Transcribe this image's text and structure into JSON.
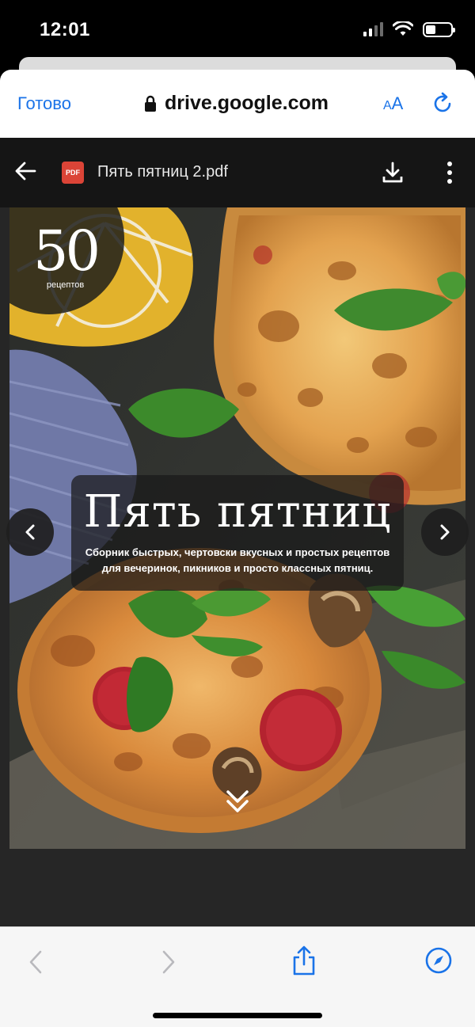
{
  "status": {
    "time": "12:01"
  },
  "safari": {
    "done_label": "Готово",
    "url": "drive.google.com",
    "text_size_small": "A",
    "text_size_large": "A"
  },
  "drive": {
    "pdf_badge": "PDF",
    "file_name": "Пять пятниц 2.pdf"
  },
  "cover": {
    "count": "50",
    "count_label": "рецептов",
    "title": "Пять пятниц",
    "subtitle_line1": "Сборник быстрых, чертовски вкусных и простых рецептов",
    "subtitle_line2": "для вечеринок, пикников и просто классных пятниц."
  },
  "colors": {
    "accent": "#1a73e8",
    "pdf_red": "#db4437",
    "viewer_bg": "#262626"
  }
}
